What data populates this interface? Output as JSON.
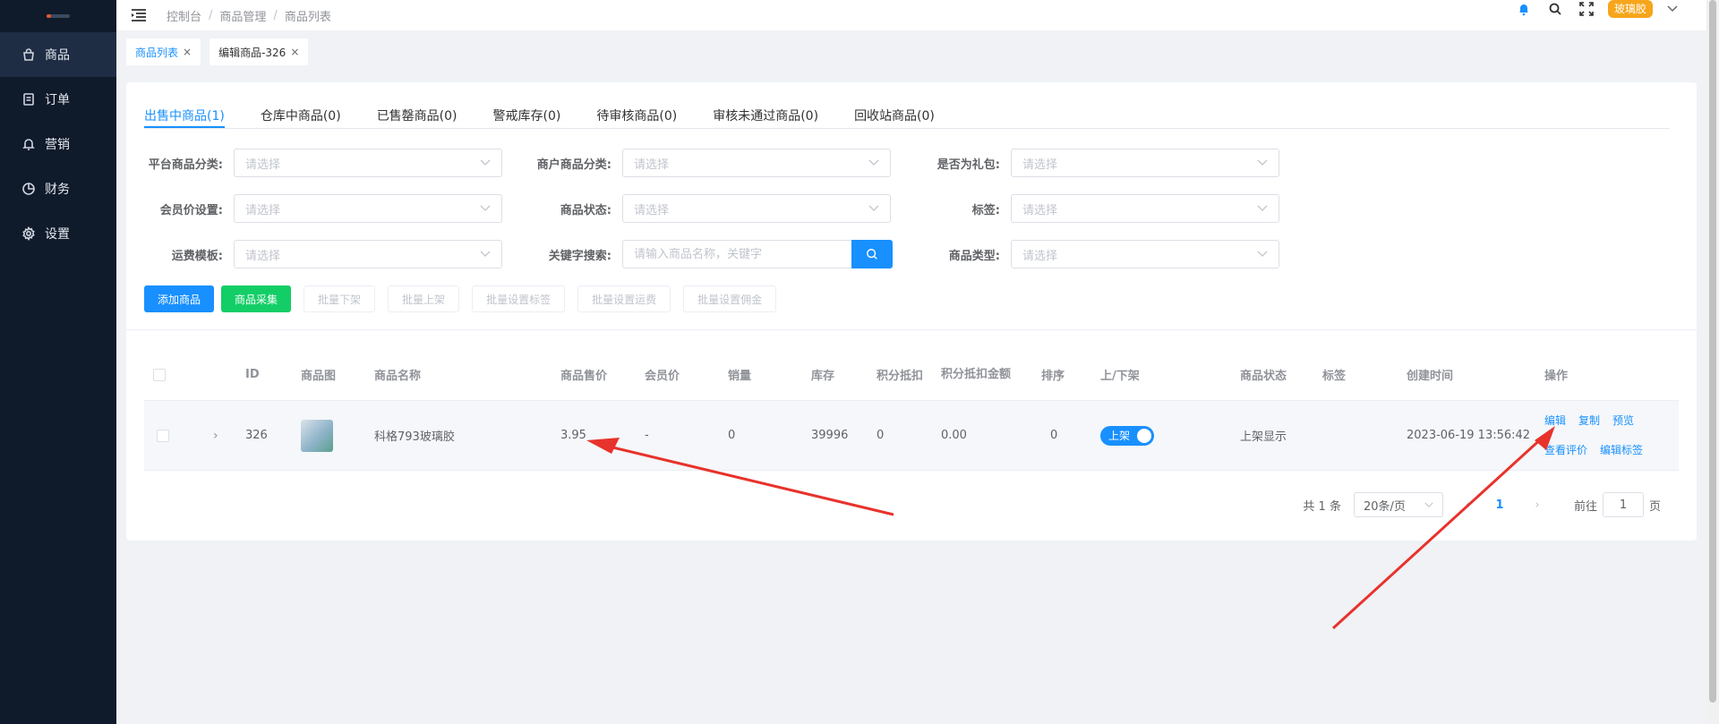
{
  "sidebar": {
    "items": [
      {
        "label": "商品",
        "icon": "bag-icon",
        "active": true
      },
      {
        "label": "订单",
        "icon": "document-icon"
      },
      {
        "label": "营销",
        "icon": "bell-icon"
      },
      {
        "label": "财务",
        "icon": "pie-chart-icon"
      },
      {
        "label": "设置",
        "icon": "gear-icon"
      }
    ]
  },
  "topbar": {
    "breadcrumb": [
      "控制台",
      "商品管理",
      "商品列表"
    ],
    "user_name": "玻璃胶"
  },
  "tags": [
    {
      "label": "商品列表",
      "active": true
    },
    {
      "label": "编辑商品-326",
      "active": false
    }
  ],
  "tabs": [
    {
      "label": "出售中商品(1)",
      "active": true
    },
    {
      "label": "仓库中商品(0)"
    },
    {
      "label": "已售罄商品(0)"
    },
    {
      "label": "警戒库存(0)"
    },
    {
      "label": "待审核商品(0)"
    },
    {
      "label": "审核未通过商品(0)"
    },
    {
      "label": "回收站商品(0)"
    }
  ],
  "filters": {
    "platform_category": {
      "label": "平台商品分类:",
      "placeholder": "请选择"
    },
    "merchant_category": {
      "label": "商户商品分类:",
      "placeholder": "请选择"
    },
    "is_gift": {
      "label": "是否为礼包:",
      "placeholder": "请选择"
    },
    "member_price": {
      "label": "会员价设置:",
      "placeholder": "请选择"
    },
    "status": {
      "label": "商品状态:",
      "placeholder": "请选择"
    },
    "tag": {
      "label": "标签:",
      "placeholder": "请选择"
    },
    "shipping": {
      "label": "运费模板:",
      "placeholder": "请选择"
    },
    "keyword": {
      "label": "关键字搜索:",
      "placeholder": "请输入商品名称，关键字"
    },
    "type": {
      "label": "商品类型:",
      "placeholder": "请选择"
    }
  },
  "buttons": {
    "add": "添加商品",
    "collect": "商品采集",
    "batch_off": "批量下架",
    "batch_on": "批量上架",
    "batch_tag": "批量设置标签",
    "batch_shipping": "批量设置运费",
    "batch_commission": "批量设置佣金"
  },
  "table": {
    "headers": {
      "id": "ID",
      "image": "商品图",
      "name": "商品名称",
      "price": "商品售价",
      "member_price": "会员价",
      "sales": "销量",
      "stock": "库存",
      "points": "积分抵扣",
      "points_amount": "积分抵扣金额",
      "sort": "排序",
      "shelf": "上/下架",
      "status": "商品状态",
      "tags": "标签",
      "created": "创建时间",
      "ops": "操作"
    },
    "rows": [
      {
        "id": "326",
        "name": "科格793玻璃胶",
        "price": "3.95",
        "member_price": "-",
        "sales": "0",
        "stock": "39996",
        "points": "0",
        "points_amount": "0.00",
        "sort": "0",
        "shelf_label": "上架",
        "status": "上架显示",
        "tags": "",
        "created": "2023-06-19 13:56:42",
        "ops": {
          "edit": "编辑",
          "copy": "复制",
          "preview": "预览",
          "reviews": "查看评价",
          "edit_tags": "编辑标签"
        }
      }
    ]
  },
  "pagination": {
    "total": "共 1 条",
    "page_size": "20条/页",
    "current": "1",
    "goto_prefix": "前往",
    "goto_value": "1",
    "goto_suffix": "页"
  },
  "colors": {
    "primary": "#1890ff",
    "success": "#13ce66",
    "sidebar": "#0f1a2b",
    "annotation": "#e8322c"
  }
}
